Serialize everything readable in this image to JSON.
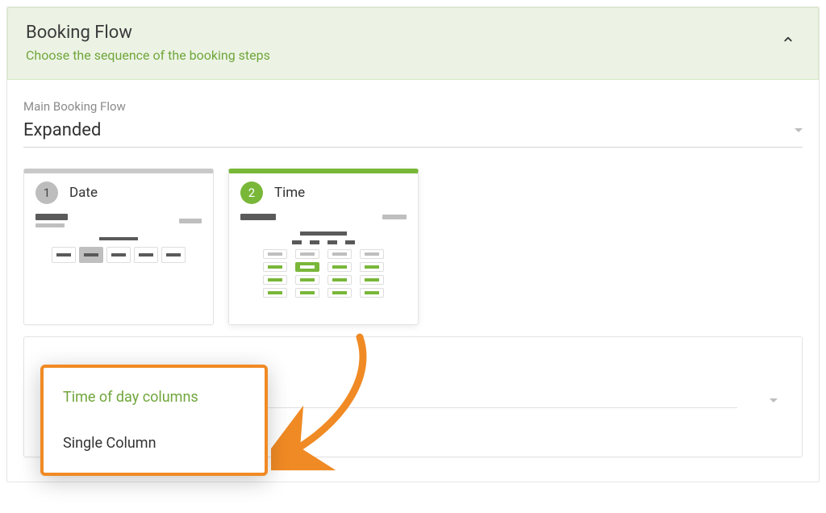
{
  "header": {
    "title": "Booking Flow",
    "subtitle": "Choose the sequence of the booking steps"
  },
  "mainFlow": {
    "label": "Main Booking Flow",
    "value": "Expanded"
  },
  "steps": [
    {
      "number": "1",
      "title": "Date",
      "state": "inactive"
    },
    {
      "number": "2",
      "title": "Time",
      "state": "active"
    }
  ],
  "timeLayoutDropdown": {
    "options": [
      {
        "label": "Time of day columns",
        "selected": true
      },
      {
        "label": "Single Column",
        "selected": false
      }
    ]
  },
  "colors": {
    "accent": "#79b739",
    "headerBg": "#ecf3e5",
    "highlight": "#F08A24"
  }
}
